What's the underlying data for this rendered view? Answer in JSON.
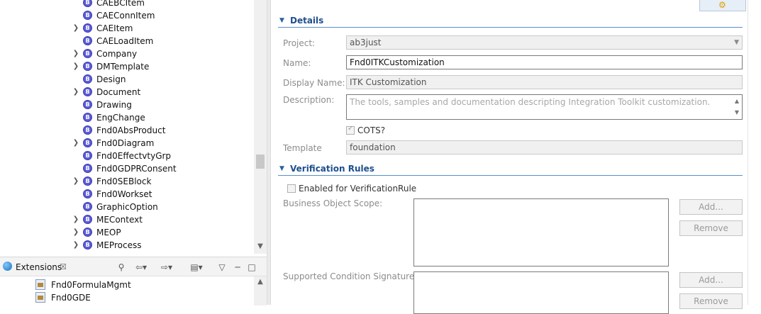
{
  "tree": {
    "items": [
      {
        "label": "CAEBCItem",
        "expandable": false
      },
      {
        "label": "CAEConnItem",
        "expandable": false
      },
      {
        "label": "CAEItem",
        "expandable": true
      },
      {
        "label": "CAELoadItem",
        "expandable": false
      },
      {
        "label": "Company",
        "expandable": true
      },
      {
        "label": "DMTemplate",
        "expandable": true
      },
      {
        "label": "Design",
        "expandable": false
      },
      {
        "label": "Document",
        "expandable": true
      },
      {
        "label": "Drawing",
        "expandable": false
      },
      {
        "label": "EngChange",
        "expandable": false
      },
      {
        "label": "Fnd0AbsProduct",
        "expandable": false
      },
      {
        "label": "Fnd0Diagram",
        "expandable": true
      },
      {
        "label": "Fnd0EffectvtyGrp",
        "expandable": false
      },
      {
        "label": "Fnd0GDPRConsent",
        "expandable": false
      },
      {
        "label": "Fnd0SEBlock",
        "expandable": true
      },
      {
        "label": "Fnd0Workset",
        "expandable": false
      },
      {
        "label": "GraphicOption",
        "expandable": false
      },
      {
        "label": "MEContext",
        "expandable": true
      },
      {
        "label": "MEOP",
        "expandable": true
      },
      {
        "label": "MEProcess",
        "expandable": true
      }
    ]
  },
  "extensions_view": {
    "title": "Extensions",
    "close_glyph": "☒",
    "items": [
      "Fnd0FormulaMgmt",
      "Fnd0GDE"
    ]
  },
  "details": {
    "section_title": "Details",
    "project_label": "Project:",
    "project_value": "ab3just",
    "name_label": "Name:",
    "name_value": "Fnd0ITKCustomization",
    "display_name_label": "Display Name:",
    "display_name_value": "ITK Customization",
    "description_label": "Description:",
    "description_value": "The tools, samples and documentation descripting Integration Toolkit customization.",
    "cots_label": "COTS?",
    "cots_checked": true,
    "template_label": "Template",
    "template_value": "foundation"
  },
  "verification": {
    "section_title": "Verification Rules",
    "enabled_label": "Enabled for VerificationRule",
    "enabled_checked": false,
    "scope_label": "Business Object Scope:",
    "signatures_label": "Supported Condition Signatures:",
    "add_label": "Add...",
    "remove_label": "Remove"
  }
}
